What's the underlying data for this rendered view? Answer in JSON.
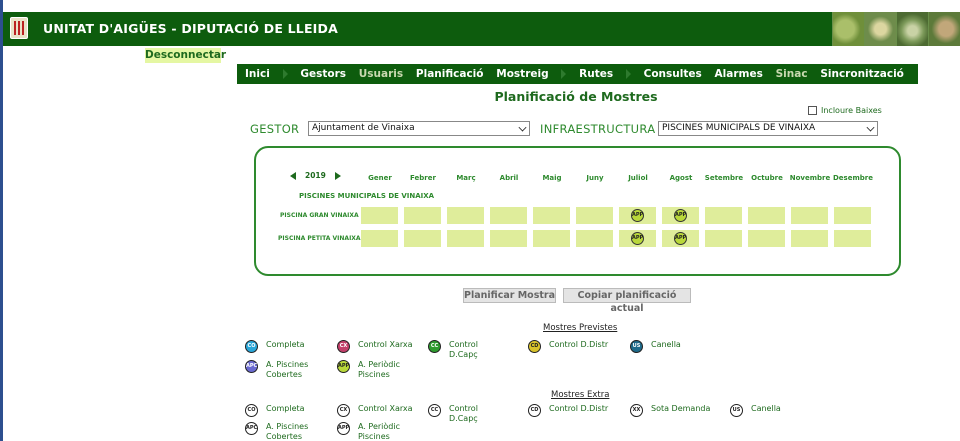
{
  "header": {
    "title": "UNITAT D'AIGÜES - DIPUTACIÓ DE LLEIDA"
  },
  "disconnect": "Desconnectar",
  "nav": [
    {
      "label": "Inici",
      "dim": false
    },
    {
      "label": "Gestors",
      "dim": false
    },
    {
      "label": "Usuaris",
      "dim": true
    },
    {
      "label": "Planificació",
      "dim": false
    },
    {
      "label": "Mostreig",
      "dim": false
    },
    {
      "label": "Rutes",
      "dim": false
    },
    {
      "label": "Consultes",
      "dim": false
    },
    {
      "label": "Alarmes",
      "dim": false
    },
    {
      "label": "Sinac",
      "dim": true
    },
    {
      "label": "Sincronització",
      "dim": false
    }
  ],
  "page_title": "Planificació de Mostres",
  "include_low": "Incloure Baixes",
  "gestor": {
    "label": "GESTOR",
    "value": "Ajuntament de Vinaixa"
  },
  "infra": {
    "label": "INFRAESTRUCTURA",
    "value": "PISCINES MUNICIPALS DE VINAIXA"
  },
  "planner": {
    "year": "2019",
    "months": [
      "Gener",
      "Febrer",
      "Març",
      "Abril",
      "Maig",
      "Juny",
      "Juliol",
      "Agost",
      "Setembre",
      "Octubre",
      "Novembre",
      "Desembre"
    ],
    "infra_title": "PISCINES MUNICIPALS DE VINAIXA",
    "rows": [
      {
        "label": "PISCINA GRAN VINAIXA",
        "cells": [
          "",
          "",
          "",
          "",
          "",
          "",
          "APP",
          "APP",
          "",
          "",
          "",
          ""
        ]
      },
      {
        "label": "PISCINA PETITA VINAIXA",
        "cells": [
          "",
          "",
          "",
          "",
          "",
          "",
          "APP",
          "APP",
          "",
          "",
          "",
          ""
        ]
      }
    ]
  },
  "buttons": {
    "plan": "Planificar Mostra",
    "copy": "Copiar planificació actual"
  },
  "legend_prev": {
    "title": "Mostres Previstes",
    "items": [
      {
        "code": "CO",
        "label": "Completa",
        "color": "#2aa6d8"
      },
      {
        "code": "CX",
        "label": "Control Xarxa",
        "color": "#c2406a"
      },
      {
        "code": "CC",
        "label": "Control D.Capç",
        "color": "#2e9a2e"
      },
      {
        "code": "CD",
        "label": "Control D.Distr",
        "color": "#d8c22a"
      },
      {
        "code": "US",
        "label": "Canella",
        "color": "#1e6a8a"
      },
      {
        "code": "APC",
        "label": "A. Piscines Cobertes",
        "color": "#6a6ad0"
      },
      {
        "code": "APP",
        "label": "A. Periòdic Piscines",
        "color": "#b9d83a"
      }
    ]
  },
  "legend_extra": {
    "title": "Mostres Extra",
    "items": [
      {
        "code": "CO",
        "label": "Completa"
      },
      {
        "code": "CX",
        "label": "Control Xarxa"
      },
      {
        "code": "CC",
        "label": "Control D.Capç"
      },
      {
        "code": "CD",
        "label": "Control D.Distr"
      },
      {
        "code": "XX",
        "label": "Sota Demanda"
      },
      {
        "code": "US",
        "label": "Canella"
      },
      {
        "code": "APC",
        "label": "A. Piscines Cobertes"
      },
      {
        "code": "APP",
        "label": "A. Periòdic Piscines"
      }
    ]
  }
}
